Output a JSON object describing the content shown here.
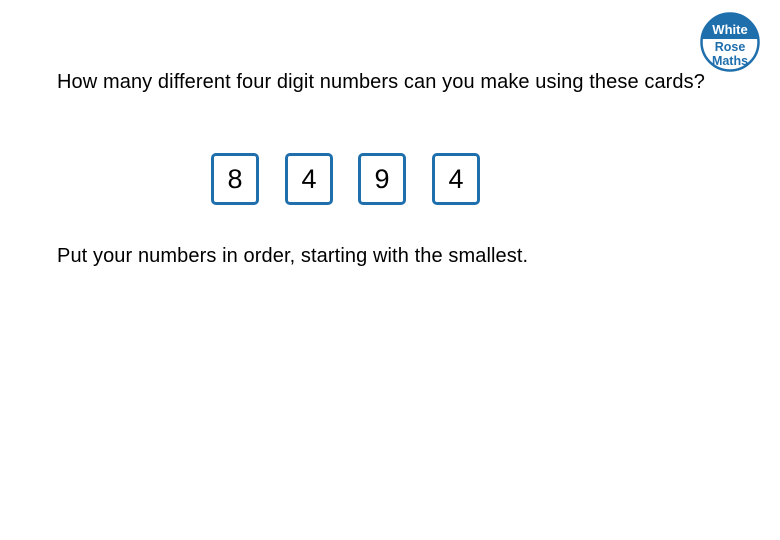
{
  "logo": {
    "line1": "White",
    "line2": "Rose",
    "line3": "Maths",
    "brand_color": "#1f6fad"
  },
  "question": {
    "text": "How many different four digit numbers can you make using these cards?"
  },
  "cards": [
    {
      "digit": "8"
    },
    {
      "digit": "4"
    },
    {
      "digit": "9"
    },
    {
      "digit": "4"
    }
  ],
  "instruction": {
    "text": "Put your numbers in order, starting with the smallest."
  },
  "colors": {
    "card_border": "#1f6fad",
    "text": "#000000"
  }
}
